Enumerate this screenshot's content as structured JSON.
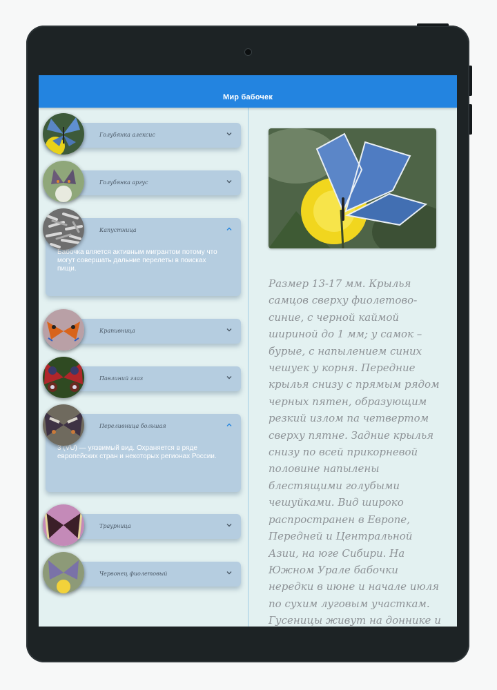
{
  "app": {
    "title": "Мир бабочек"
  },
  "butterflies": [
    {
      "name": "Голубянка алексис",
      "expanded": false,
      "description": ""
    },
    {
      "name": "Голубянка аргус",
      "expanded": false,
      "description": ""
    },
    {
      "name": "Капустница",
      "expanded": true,
      "description": "Бабочка вляется активным мигрантом потому что могут совершать дальние перелеты в поисках пищи."
    },
    {
      "name": "Крапивница",
      "expanded": false,
      "description": ""
    },
    {
      "name": "Павлиний глаз",
      "expanded": false,
      "description": ""
    },
    {
      "name": "Переливница большая",
      "expanded": true,
      "description": "3 (VU) — уязвимый вид. Охраняется в ряде европейских стран и некоторых регионах России."
    },
    {
      "name": "Траурница",
      "expanded": false,
      "description": ""
    },
    {
      "name": "Червонец фиолетовый",
      "expanded": false,
      "description": ""
    }
  ],
  "detail": {
    "text": "Размер 13-17 мм. Крылья самцов сверху фиолетово-синие, с черной каймой шириной до 1 мм; у самок – бурые, с напылением синих чешуек у корня. Передние крылья снизу с прямым рядом черных пятен, образующим резкий излом па четвертом сверху пятне. Задние крылья снизу по всей прикорневой половине напылены блестящими голубыми чешуйками. Вид широко распространен в Европе, Передней и Центральной Азии, на юге Сибири. На Южном Урале бабочки нередки в июне и начале июля по сухим луговым участкам. Гусеницы живут на доннике и других бобовых"
  },
  "colors": {
    "appbar": "#2384e0",
    "card": "#b5cde0",
    "background": "#e3f1f1"
  }
}
